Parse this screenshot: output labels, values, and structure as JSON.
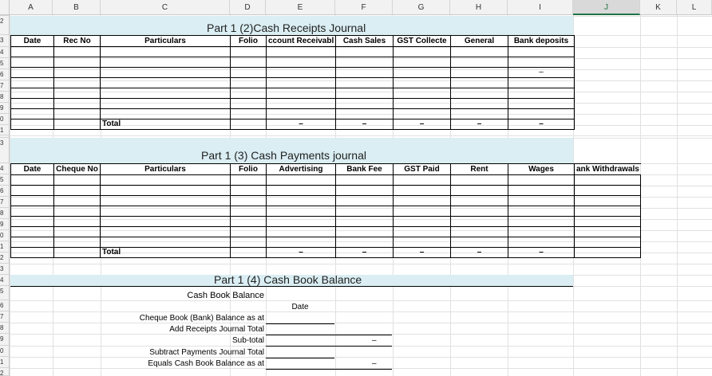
{
  "columns": [
    "A",
    "B",
    "C",
    "D",
    "E",
    "F",
    "G",
    "H",
    "I",
    "J",
    "K",
    "L"
  ],
  "selected_column": "J",
  "rows": [
    "1",
    "2",
    "3",
    "4",
    "5",
    "6",
    "7",
    "8",
    "9",
    "0",
    "1",
    "2",
    "3",
    "4",
    "5",
    "6",
    "7",
    "8",
    "9",
    "0",
    "1",
    "2",
    "3",
    "4",
    "5",
    "6",
    "7",
    "8",
    "9",
    "0",
    "1",
    "2",
    "3",
    "4",
    "5",
    "6",
    "7",
    "8",
    "9"
  ],
  "receipts": {
    "title": "Part 1 (2)Cash Receipts Journal",
    "headers": [
      "Date",
      "Rec No",
      "Particulars",
      "Folio",
      "Accounts Receivable",
      "Cash Sales",
      "GST Collected",
      "General",
      "Bank deposits"
    ],
    "header_display": [
      "Date",
      "Rec No",
      "Particulars",
      "Folio",
      "ccount Receivabl",
      "Cash Sales",
      "GST Collecte",
      "General",
      "Bank deposits"
    ],
    "row5_bank": "–",
    "total_label": "Total",
    "total_dash": "–"
  },
  "payments": {
    "title": "Part 1 (3) Cash Payments journal",
    "headers": [
      "Date",
      "Cheque No",
      "Particulars",
      "Folio",
      "Advertising",
      "Bank Fee",
      "GST Paid",
      "Rent",
      "Wages",
      "Bank Withdrawals"
    ],
    "header_display": [
      "Date",
      "Cheque No",
      "Particulars",
      "Folio",
      "Advertising",
      "Bank Fee",
      "GST Paid",
      "Rent",
      "Wages",
      "ank Withdrawals"
    ],
    "total_label": "Total",
    "total_dash": "–"
  },
  "balance": {
    "title": "Part 1 (4) Cash Book Balance",
    "subtitle": "Cash Book Balance",
    "date_label": "Date",
    "lines": [
      "Cheque Book (Bank) Balance as at",
      "Add Receipts Journal Total",
      "Sub-total",
      "Subtract Payments Journal Total",
      "Equals Cash Book Balance as at"
    ],
    "dash": "–"
  }
}
